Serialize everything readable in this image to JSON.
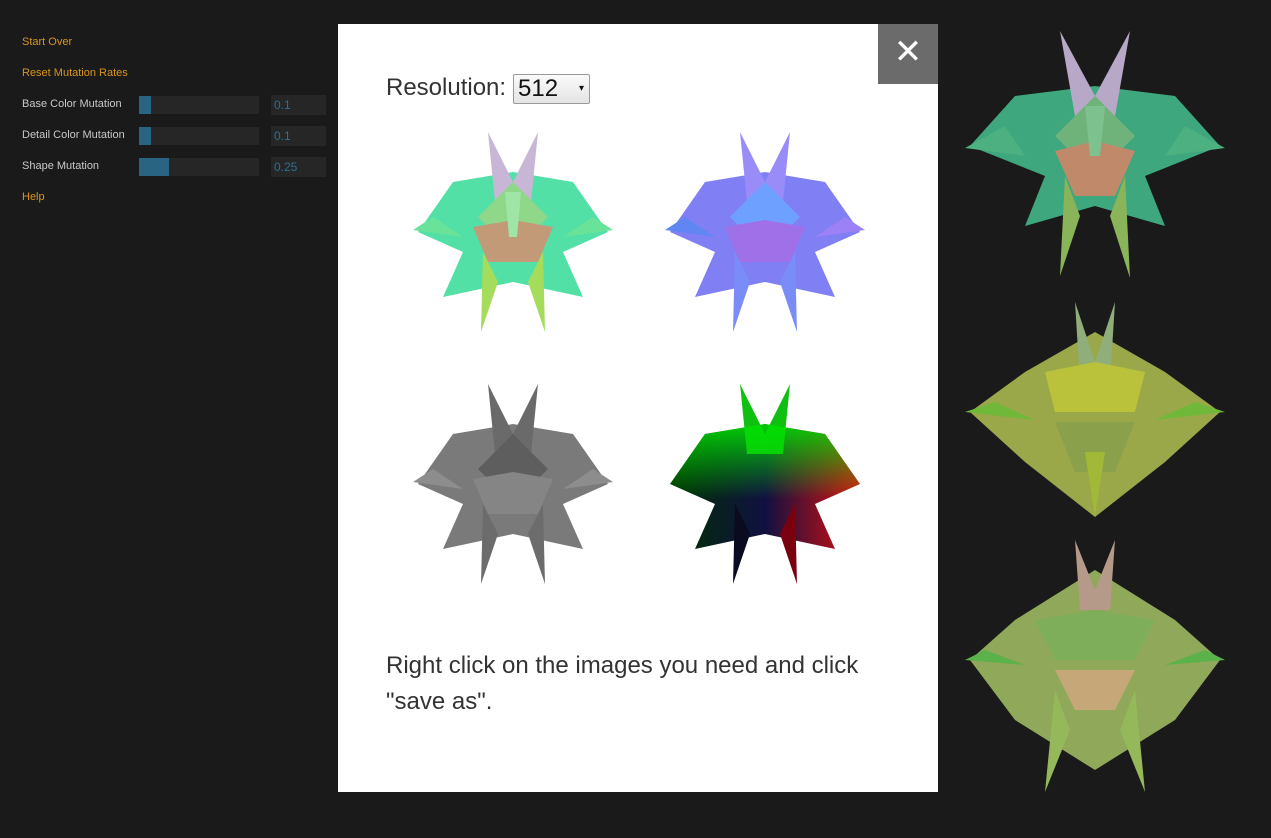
{
  "controls": {
    "start_over": "Start Over",
    "reset_rates": "Reset Mutation Rates",
    "help": "Help",
    "sliders": [
      {
        "label": "Base Color Mutation",
        "value": "0.1",
        "fraction": 0.1
      },
      {
        "label": "Detail Color Mutation",
        "value": "0.1",
        "fraction": 0.1
      },
      {
        "label": "Shape Mutation",
        "value": "0.25",
        "fraction": 0.25
      }
    ]
  },
  "modal": {
    "close_symbol": "✕",
    "resolution_label": "Resolution:",
    "resolution_value": "512",
    "caret": "▾",
    "hint": "Right click on the images you need and click \"save as\"."
  },
  "colors": {
    "link": "#d9951f",
    "slider_fill": "#2a6483",
    "value_text": "#2c6f92",
    "background": "#1a1a1a"
  }
}
